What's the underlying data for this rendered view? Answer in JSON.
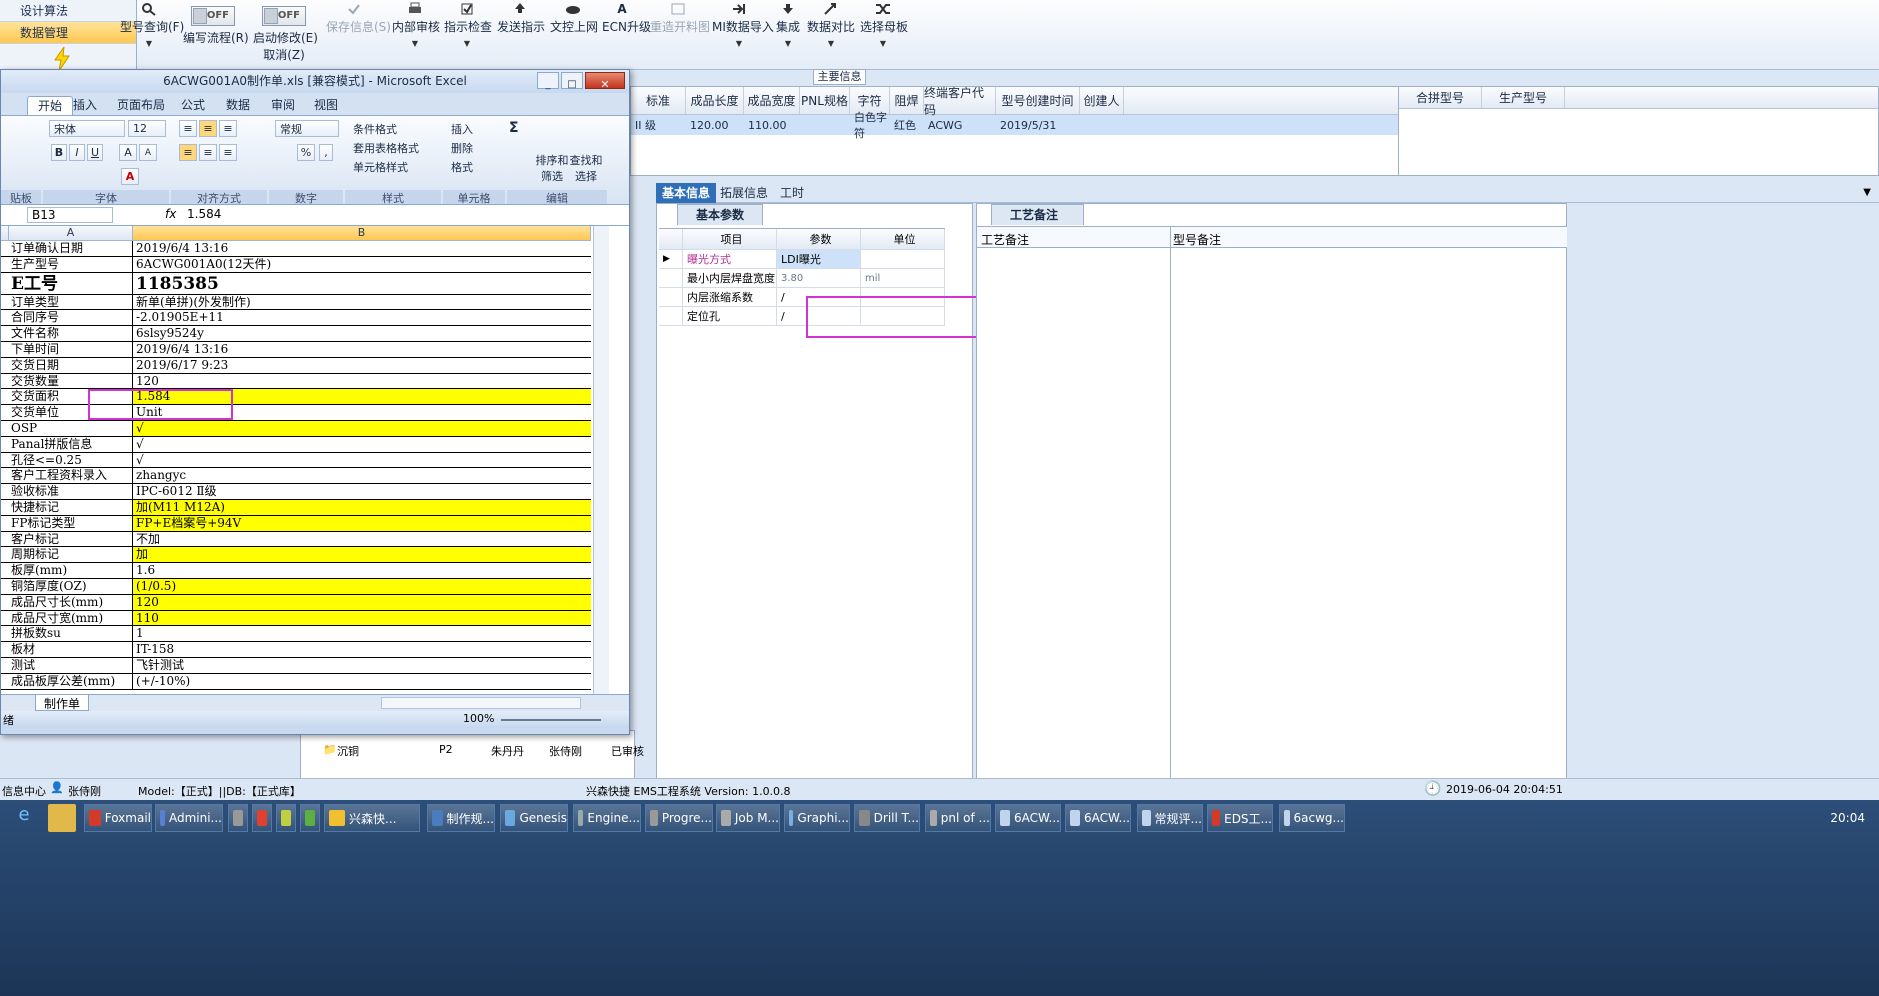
{
  "navtree": {
    "items": [
      {
        "label": "设计算法",
        "active": false
      },
      {
        "label": "数据管理",
        "active": true
      }
    ]
  },
  "ribbon": {
    "buttons": [
      {
        "label": "型号查询(F)",
        "icon": "search-icon",
        "disabled": false
      },
      {
        "label": "编写流程(R)",
        "icon": "toggle-icon",
        "disabled": false,
        "toggle": "OFF"
      },
      {
        "label": "启动修改(E)",
        "sub": "取消(Z)",
        "icon": "toggle-icon",
        "disabled": false,
        "toggle": "OFF"
      },
      {
        "label": "保存信息(S)",
        "icon": "check-icon",
        "disabled": true
      },
      {
        "label": "内部审核",
        "icon": "printer-icon",
        "disabled": false
      },
      {
        "label": "指示检查",
        "icon": "checkbox-icon",
        "disabled": false
      },
      {
        "label": "发送指示",
        "icon": "upload-icon",
        "disabled": false
      },
      {
        "label": "文控上网",
        "icon": "cloud-icon",
        "disabled": false
      },
      {
        "label": "ECN升级",
        "icon": "letter-a-icon",
        "disabled": false
      },
      {
        "label": "重造开料图",
        "icon": "image-icon",
        "disabled": true
      },
      {
        "label": "MI数据导入",
        "icon": "import-icon",
        "disabled": false
      },
      {
        "label": "集成",
        "icon": "download-icon",
        "disabled": false
      },
      {
        "label": "数据对比",
        "icon": "compare-icon",
        "disabled": false
      },
      {
        "label": "选择母板",
        "icon": "shuffle-icon",
        "disabled": false
      }
    ]
  },
  "main_info": {
    "title": "主要信息",
    "columns": [
      "标准",
      "成品长度",
      "成品宽度",
      "PNL规格",
      "字符",
      "阻焊",
      "终端客户代码",
      "型号创建时间",
      "创建人"
    ],
    "row": [
      "II 级",
      "120.00",
      "110.00",
      "",
      "白色字符",
      "红色",
      "ACWG",
      "2019/5/31",
      ""
    ],
    "side_columns": [
      "合拼型号",
      "生产型号"
    ]
  },
  "detail_tabs": [
    "基本信息",
    "拓展信息",
    "工时"
  ],
  "basic_params": {
    "tab": "基本参数",
    "columns": [
      "项目",
      "参数",
      "单位"
    ],
    "rows": [
      {
        "item": "曝光方式",
        "value": "LDI曝光",
        "unit": ""
      },
      {
        "item": "最小内层焊盘宽度",
        "value": "3.80",
        "unit": "mil"
      },
      {
        "item": "内层涨缩系数",
        "value": "/",
        "unit": ""
      },
      {
        "item": "定位孔",
        "value": "/",
        "unit": ""
      }
    ]
  },
  "process_notes": {
    "tab": "工艺备注",
    "columns": [
      "工艺备注",
      "型号备注"
    ]
  },
  "tree_behind": {
    "rows": [
      {
        "name": "沉铜",
        "code": "P2",
        "p1": "朱丹丹",
        "p2": "张侍刚",
        "status": "已审核"
      }
    ]
  },
  "status": {
    "left": "信息中心",
    "user": "张侍刚",
    "model": "Model:【正式】||DB:【正式库】",
    "version": "兴森快捷 EMS工程系统 Version: 1.0.0.8",
    "datetime": "2019-06-04 20:04:51"
  },
  "taskbar": {
    "items": [
      "Foxmail",
      "Admini...",
      "",
      "",
      "",
      "",
      "兴森快...",
      "制作规...",
      "Genesis",
      "Engine...",
      "Progre...",
      "Job M...",
      "Graphi...",
      "Drill T...",
      "pnl of ...",
      "6ACW...",
      "6ACW...",
      "常规评...",
      "EDS工...",
      "6acwg..."
    ],
    "clock": "20:04"
  },
  "excel": {
    "title": "6ACWG001A0制作单.xls [兼容模式] - Microsoft Excel",
    "tabs": [
      "开始",
      "插入",
      "页面布局",
      "公式",
      "数据",
      "审阅",
      "视图"
    ],
    "font": "宋体",
    "font_size": "12",
    "number_format": "常规",
    "groups": [
      "贴板",
      "字体",
      "对齐方式",
      "数字",
      "样式",
      "单元格",
      "编辑"
    ],
    "style_buttons": [
      "条件格式",
      "套用表格格式",
      "单元格样式"
    ],
    "cell_buttons": [
      "插入",
      "删除",
      "格式"
    ],
    "edit_buttons": [
      "排序和筛选",
      "查找和选择"
    ],
    "cell_ref": "B13",
    "formula": "1.584",
    "col_a": "A",
    "col_b": "B",
    "rows": [
      {
        "a": "订单确认日期",
        "b": "2019/6/4 13:16",
        "y": false
      },
      {
        "a": "生产型号",
        "b": "6ACWG001A0(12天件)",
        "y": false
      },
      {
        "a": "E工号",
        "b": "1185385",
        "y": false,
        "big": true
      },
      {
        "a": "订单类型",
        "b": "新单(单拼)(外发制作)",
        "y": false
      },
      {
        "a": "合同序号",
        "b": "-2.01905E+11",
        "y": false
      },
      {
        "a": "文件名称",
        "b": "6slsy9524y",
        "y": false
      },
      {
        "a": "下单时间",
        "b": "2019/6/4 13:16",
        "y": false
      },
      {
        "a": "交货日期",
        "b": "2019/6/17 9:23",
        "y": false
      },
      {
        "a": "交货数量",
        "b": "120",
        "y": false
      },
      {
        "a": "交货面积",
        "b": "1.584",
        "y": true
      },
      {
        "a": "交货单位",
        "b": "Unit",
        "y": false
      },
      {
        "a": "OSP",
        "b": "√",
        "y": true
      },
      {
        "a": "Panal拼版信息",
        "b": "√",
        "y": false
      },
      {
        "a": "孔径<=0.25",
        "b": "√",
        "y": false
      },
      {
        "a": "客户工程资料录入",
        "b": "zhangyc",
        "y": false
      },
      {
        "a": "验收标准",
        "b": "IPC-6012 Ⅱ级",
        "y": false
      },
      {
        "a": "快捷标记",
        "b": "加(M11 M12A)",
        "y": true
      },
      {
        "a": "FP标记类型",
        "b": "FP+E档案号+94V",
        "y": true
      },
      {
        "a": "客户标记",
        "b": "不加",
        "y": false
      },
      {
        "a": "周期标记",
        "b": "加",
        "y": true
      },
      {
        "a": "板厚(mm)",
        "b": "1.6",
        "y": false
      },
      {
        "a": "铜箔厚度(OZ)",
        "b": "(1/0.5)",
        "y": true
      },
      {
        "a": "成品尺寸长(mm)",
        "b": "120",
        "y": true
      },
      {
        "a": "成品尺寸宽(mm)",
        "b": "110",
        "y": true
      },
      {
        "a": "拼板数su",
        "b": "1",
        "y": false
      },
      {
        "a": "板材",
        "b": "IT-158",
        "y": false
      },
      {
        "a": "测试",
        "b": "飞针测试",
        "y": false
      },
      {
        "a": "成品板厚公差(mm)",
        "b": "(+/-10%)",
        "y": false
      }
    ],
    "sheet_tab": "制作单",
    "zoom": "100%",
    "status_left": "绪"
  },
  "colors": {
    "highlight_magenta": "#d433d4",
    "cell_yellow": "#ffff00",
    "tab_active": "#2f6fb8"
  }
}
